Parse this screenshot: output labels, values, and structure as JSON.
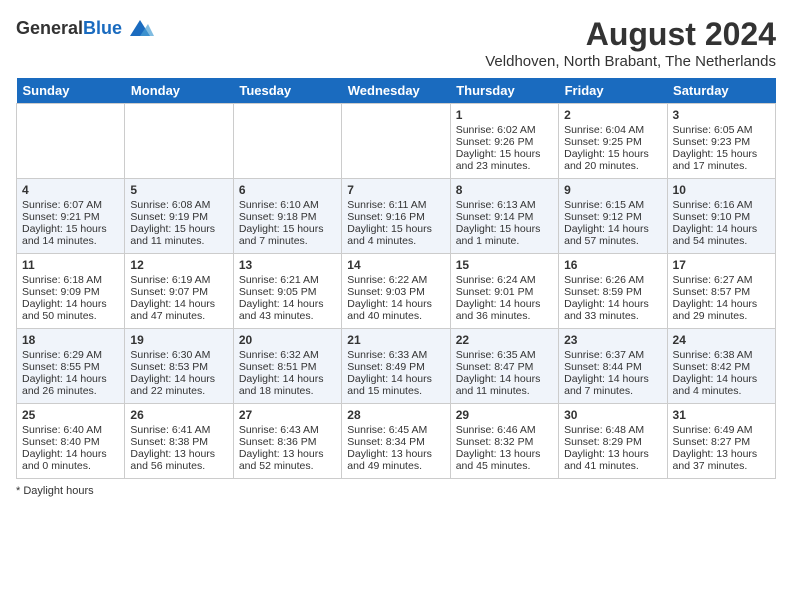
{
  "header": {
    "logo_general": "General",
    "logo_blue": "Blue",
    "month_year": "August 2024",
    "location": "Veldhoven, North Brabant, The Netherlands"
  },
  "days_of_week": [
    "Sunday",
    "Monday",
    "Tuesday",
    "Wednesday",
    "Thursday",
    "Friday",
    "Saturday"
  ],
  "weeks": [
    [
      {
        "day": "",
        "content": ""
      },
      {
        "day": "",
        "content": ""
      },
      {
        "day": "",
        "content": ""
      },
      {
        "day": "",
        "content": ""
      },
      {
        "day": "1",
        "content": "Sunrise: 6:02 AM\nSunset: 9:26 PM\nDaylight: 15 hours\nand 23 minutes."
      },
      {
        "day": "2",
        "content": "Sunrise: 6:04 AM\nSunset: 9:25 PM\nDaylight: 15 hours\nand 20 minutes."
      },
      {
        "day": "3",
        "content": "Sunrise: 6:05 AM\nSunset: 9:23 PM\nDaylight: 15 hours\nand 17 minutes."
      }
    ],
    [
      {
        "day": "4",
        "content": "Sunrise: 6:07 AM\nSunset: 9:21 PM\nDaylight: 15 hours\nand 14 minutes."
      },
      {
        "day": "5",
        "content": "Sunrise: 6:08 AM\nSunset: 9:19 PM\nDaylight: 15 hours\nand 11 minutes."
      },
      {
        "day": "6",
        "content": "Sunrise: 6:10 AM\nSunset: 9:18 PM\nDaylight: 15 hours\nand 7 minutes."
      },
      {
        "day": "7",
        "content": "Sunrise: 6:11 AM\nSunset: 9:16 PM\nDaylight: 15 hours\nand 4 minutes."
      },
      {
        "day": "8",
        "content": "Sunrise: 6:13 AM\nSunset: 9:14 PM\nDaylight: 15 hours\nand 1 minute."
      },
      {
        "day": "9",
        "content": "Sunrise: 6:15 AM\nSunset: 9:12 PM\nDaylight: 14 hours\nand 57 minutes."
      },
      {
        "day": "10",
        "content": "Sunrise: 6:16 AM\nSunset: 9:10 PM\nDaylight: 14 hours\nand 54 minutes."
      }
    ],
    [
      {
        "day": "11",
        "content": "Sunrise: 6:18 AM\nSunset: 9:09 PM\nDaylight: 14 hours\nand 50 minutes."
      },
      {
        "day": "12",
        "content": "Sunrise: 6:19 AM\nSunset: 9:07 PM\nDaylight: 14 hours\nand 47 minutes."
      },
      {
        "day": "13",
        "content": "Sunrise: 6:21 AM\nSunset: 9:05 PM\nDaylight: 14 hours\nand 43 minutes."
      },
      {
        "day": "14",
        "content": "Sunrise: 6:22 AM\nSunset: 9:03 PM\nDaylight: 14 hours\nand 40 minutes."
      },
      {
        "day": "15",
        "content": "Sunrise: 6:24 AM\nSunset: 9:01 PM\nDaylight: 14 hours\nand 36 minutes."
      },
      {
        "day": "16",
        "content": "Sunrise: 6:26 AM\nSunset: 8:59 PM\nDaylight: 14 hours\nand 33 minutes."
      },
      {
        "day": "17",
        "content": "Sunrise: 6:27 AM\nSunset: 8:57 PM\nDaylight: 14 hours\nand 29 minutes."
      }
    ],
    [
      {
        "day": "18",
        "content": "Sunrise: 6:29 AM\nSunset: 8:55 PM\nDaylight: 14 hours\nand 26 minutes."
      },
      {
        "day": "19",
        "content": "Sunrise: 6:30 AM\nSunset: 8:53 PM\nDaylight: 14 hours\nand 22 minutes."
      },
      {
        "day": "20",
        "content": "Sunrise: 6:32 AM\nSunset: 8:51 PM\nDaylight: 14 hours\nand 18 minutes."
      },
      {
        "day": "21",
        "content": "Sunrise: 6:33 AM\nSunset: 8:49 PM\nDaylight: 14 hours\nand 15 minutes."
      },
      {
        "day": "22",
        "content": "Sunrise: 6:35 AM\nSunset: 8:47 PM\nDaylight: 14 hours\nand 11 minutes."
      },
      {
        "day": "23",
        "content": "Sunrise: 6:37 AM\nSunset: 8:44 PM\nDaylight: 14 hours\nand 7 minutes."
      },
      {
        "day": "24",
        "content": "Sunrise: 6:38 AM\nSunset: 8:42 PM\nDaylight: 14 hours\nand 4 minutes."
      }
    ],
    [
      {
        "day": "25",
        "content": "Sunrise: 6:40 AM\nSunset: 8:40 PM\nDaylight: 14 hours\nand 0 minutes."
      },
      {
        "day": "26",
        "content": "Sunrise: 6:41 AM\nSunset: 8:38 PM\nDaylight: 13 hours\nand 56 minutes."
      },
      {
        "day": "27",
        "content": "Sunrise: 6:43 AM\nSunset: 8:36 PM\nDaylight: 13 hours\nand 52 minutes."
      },
      {
        "day": "28",
        "content": "Sunrise: 6:45 AM\nSunset: 8:34 PM\nDaylight: 13 hours\nand 49 minutes."
      },
      {
        "day": "29",
        "content": "Sunrise: 6:46 AM\nSunset: 8:32 PM\nDaylight: 13 hours\nand 45 minutes."
      },
      {
        "day": "30",
        "content": "Sunrise: 6:48 AM\nSunset: 8:29 PM\nDaylight: 13 hours\nand 41 minutes."
      },
      {
        "day": "31",
        "content": "Sunrise: 6:49 AM\nSunset: 8:27 PM\nDaylight: 13 hours\nand 37 minutes."
      }
    ]
  ],
  "footer": {
    "note": "Daylight hours"
  }
}
